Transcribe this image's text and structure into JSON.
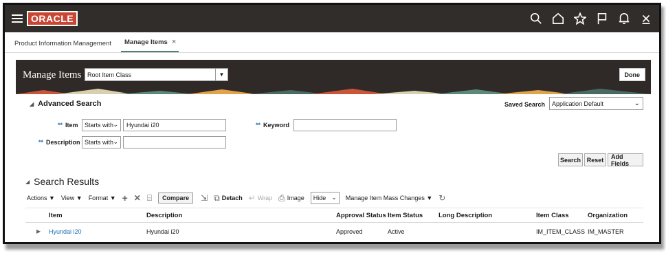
{
  "brand": {
    "logo_text": "ORACLE",
    "accent": "#c74634",
    "bar_color": "#312d2a"
  },
  "top_icons": [
    "search-icon",
    "home-icon",
    "star-icon",
    "flag-icon",
    "bell-icon",
    "user-icon"
  ],
  "tabs": [
    {
      "label": "Product Information Management"
    },
    {
      "label": "Manage Items",
      "close": "×"
    }
  ],
  "header": {
    "title": "Manage Items",
    "class_select": "Root Item Class",
    "done_label": "Done"
  },
  "advanced_search": {
    "title": "Advanced Search",
    "saved_search_label": "Saved Search",
    "saved_search_value": "Application Default",
    "item_label": "Item",
    "item_operator": "Starts with",
    "item_value": "Hyundai i20",
    "keyword_label": "Keyword",
    "keyword_value": "",
    "description_label": "Description",
    "description_operator": "Starts with",
    "description_value": "",
    "required_mark": "**",
    "search_label": "Search",
    "reset_label": "Reset",
    "add_fields_label": "Add Fields"
  },
  "results": {
    "title": "Search Results",
    "toolbar": {
      "actions": "Actions ▼",
      "view": "View ▼",
      "format": "Format ▼",
      "compare": "Compare",
      "detach": "Detach",
      "wrap": "Wrap",
      "image": "Image",
      "hide_value": "Hide",
      "mass_changes": "Manage Item Mass Changes ▼"
    },
    "columns": [
      "Item",
      "Description",
      "Approval Status",
      "Item Status",
      "Long Description",
      "Item Class",
      "Organization"
    ],
    "rows": [
      {
        "item": "Hyundai i20",
        "description": "Hyundai i20",
        "approval_status": "Approved",
        "item_status": "Active",
        "long_description": "",
        "item_class": "IM_ITEM_CLASS",
        "organization": "IM_MASTER"
      }
    ]
  }
}
